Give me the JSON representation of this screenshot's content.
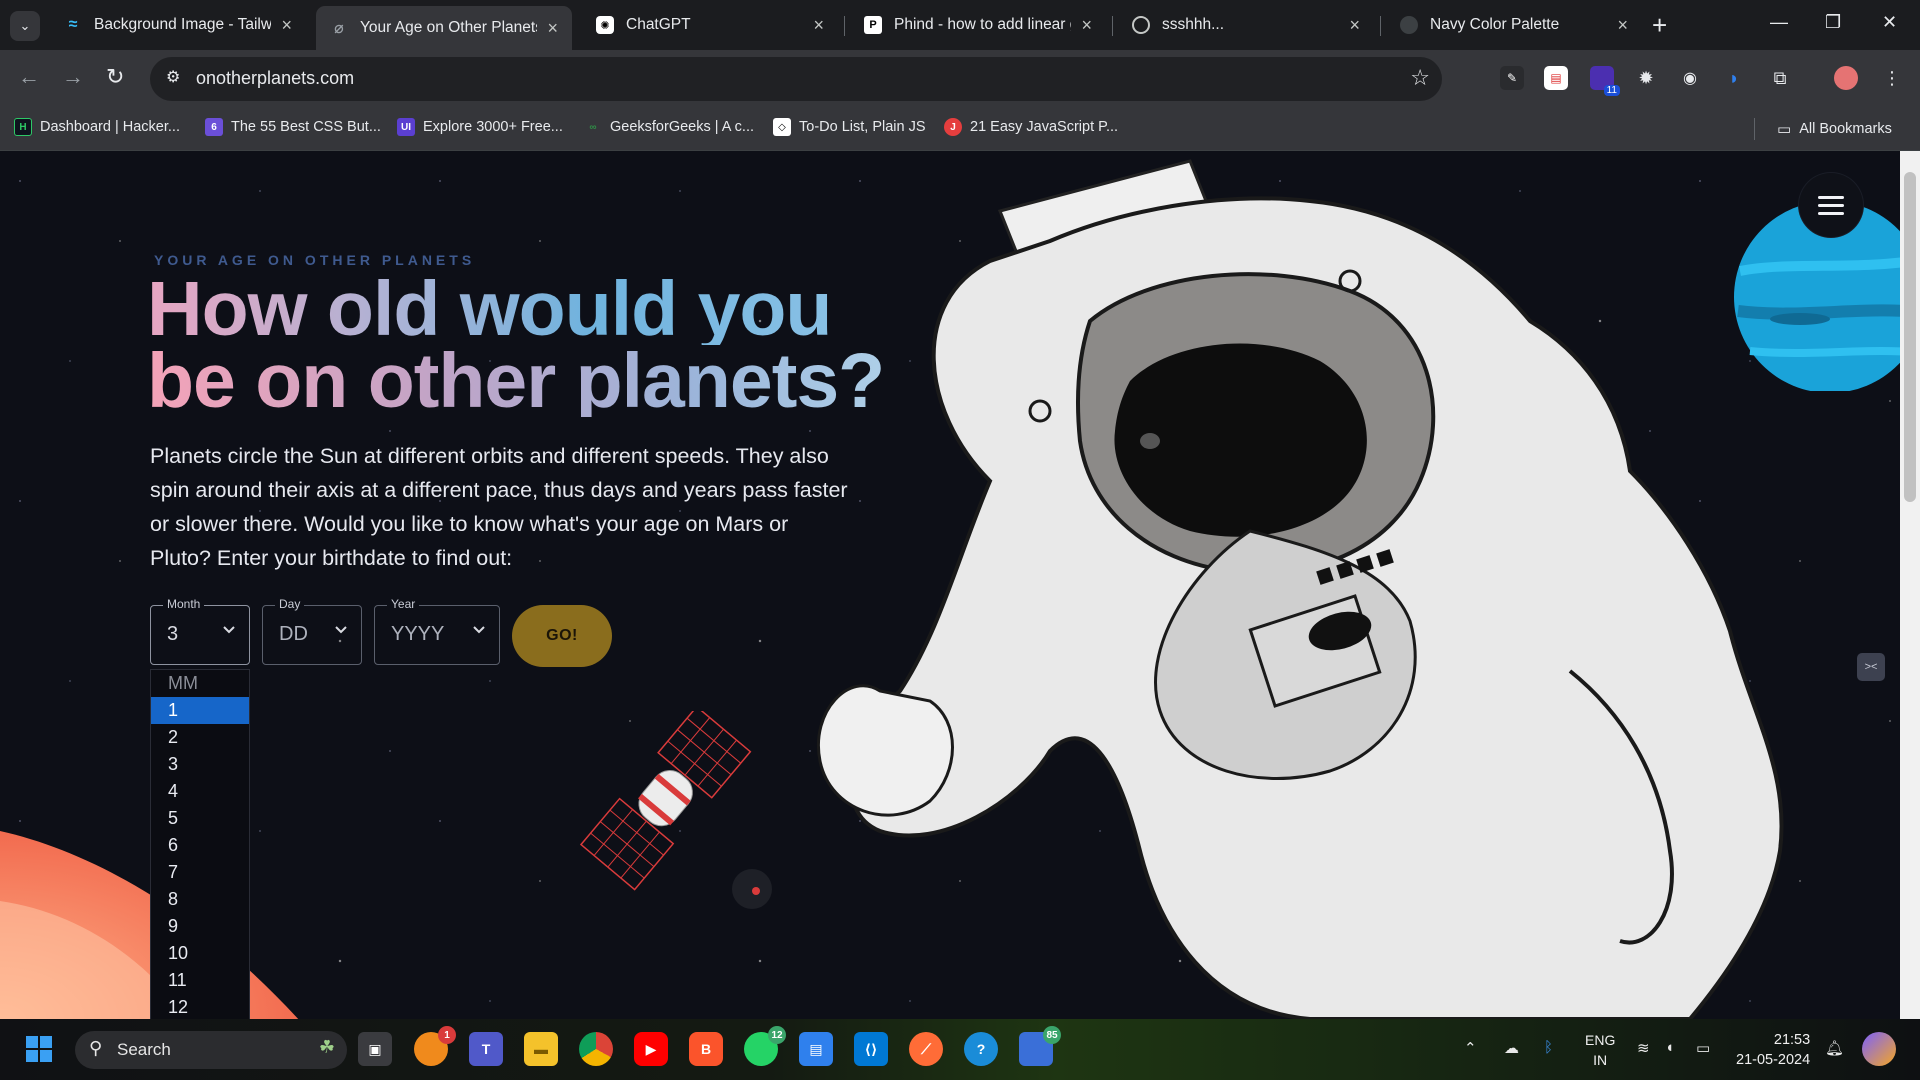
{
  "browser": {
    "tabs": [
      {
        "title": "Background Image - Tailwi",
        "active": false,
        "favicon": "tailwind-icon",
        "color": "#38bdf8"
      },
      {
        "title": "Your Age on Other Planets",
        "active": true,
        "favicon": "planet-icon",
        "color": "#9aa0a6"
      },
      {
        "title": "ChatGPT",
        "active": false,
        "favicon": "chatgpt-icon",
        "color": "#ffffff"
      },
      {
        "title": "Phind - how to add linear g",
        "active": false,
        "favicon": "phind-icon",
        "color": "#ffffff"
      },
      {
        "title": "ssshhh...",
        "active": false,
        "favicon": "globe-icon",
        "color": "#c4c7c5"
      },
      {
        "title": "Navy Color Palette",
        "active": false,
        "favicon": "palette-icon",
        "color": "#3c4043"
      }
    ],
    "url": "onotherplanets.com",
    "bookmarks": [
      {
        "label": "Dashboard | Hacker...",
        "icon": "hackerrank-icon",
        "color": "#0e141e"
      },
      {
        "label": "The 55 Best CSS But...",
        "icon": "six-icon",
        "color": "#6b4fd8"
      },
      {
        "label": "Explore 3000+ Free...",
        "icon": "uiverse-icon",
        "color": "#5b3fd1"
      },
      {
        "label": "GeeksforGeeks | A c...",
        "icon": "gfg-icon",
        "color": "#2f8d46"
      },
      {
        "label": "To-Do List, Plain JS",
        "icon": "codepen-icon",
        "color": "#ffffff"
      },
      {
        "label": "21 Easy JavaScript P...",
        "icon": "js-projects-icon",
        "color": "#e53e3e"
      }
    ],
    "all_bookmarks_label": "All Bookmarks",
    "extension_badge": "11"
  },
  "page": {
    "kicker": "YOUR AGE ON OTHER PLANETS",
    "headline_line1": "How old would you",
    "headline_line2": "be on other planets?",
    "intro": "Planets circle the Sun at different orbits and different speeds. They also spin around their axis at a different pace, thus days and years pass faster or slower there. Would you like to know what's your age on Mars or Pluto? Enter your birthdate to find out:",
    "form": {
      "month_label": "Month",
      "month_value": "3",
      "day_label": "Day",
      "day_value": "DD",
      "year_label": "Year",
      "year_value": "YYYY",
      "go_label": "GO!"
    },
    "month_dropdown": {
      "placeholder": "MM",
      "options": [
        "1",
        "2",
        "3",
        "4",
        "5",
        "6",
        "7",
        "8",
        "9",
        "10",
        "11",
        "12"
      ],
      "highlighted": "1"
    },
    "colors": {
      "background": "#0d0f17",
      "go_button": "#8a6d1d",
      "dropdown_highlight": "#1666c9",
      "kicker": "#3f5a8f"
    }
  },
  "taskbar": {
    "search_label": "Search",
    "badges": {
      "firefox": "1",
      "whatsapp": "12",
      "store": "85"
    },
    "language_line1": "ENG",
    "language_line2": "IN",
    "time": "21:53",
    "date": "21-05-2024"
  }
}
